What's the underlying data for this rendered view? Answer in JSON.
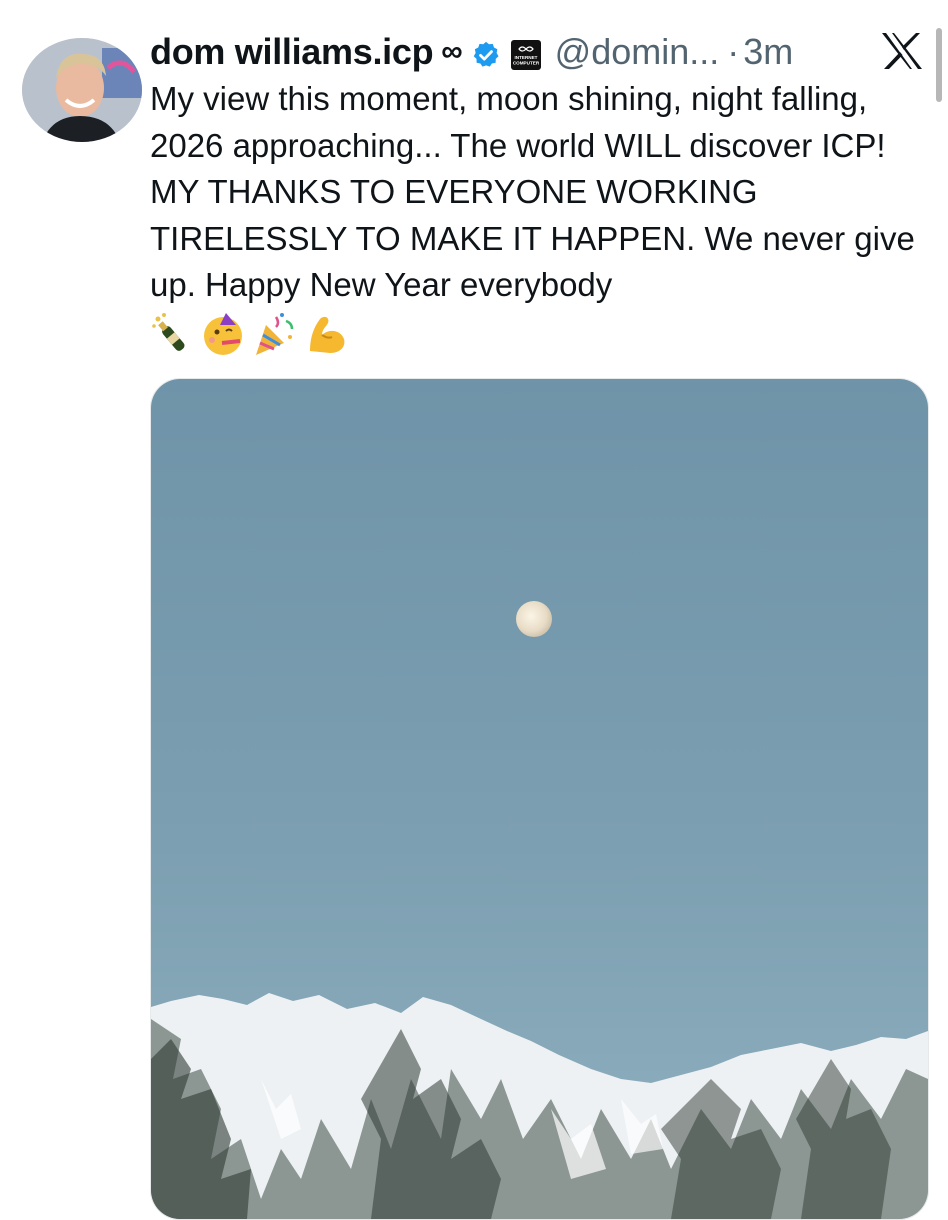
{
  "tweet": {
    "display_name": "dom williams.icp",
    "name_suffix": "∞",
    "handle": "@domin...",
    "separator": "·",
    "time": "3m",
    "text": "My view this moment, moon shining, night falling, 2026 approaching... The world WILL discover ICP! MY THANKS TO EVERYONE WORKING TIRELESSLY TO MAKE IT HAPPEN. We never give up. Happy New Year everybody",
    "emojis": [
      "champagne-emoji",
      "partying-face-emoji",
      "party-popper-emoji",
      "flexed-biceps-emoji"
    ],
    "affiliation_badge": {
      "line1": "INTERNET",
      "line2": "COMPUTER"
    },
    "colors": {
      "verified_blue": "#1d9bf0",
      "secondary_text": "#536471",
      "primary_text": "#0f1419",
      "sky": "#7c9fb1"
    }
  }
}
